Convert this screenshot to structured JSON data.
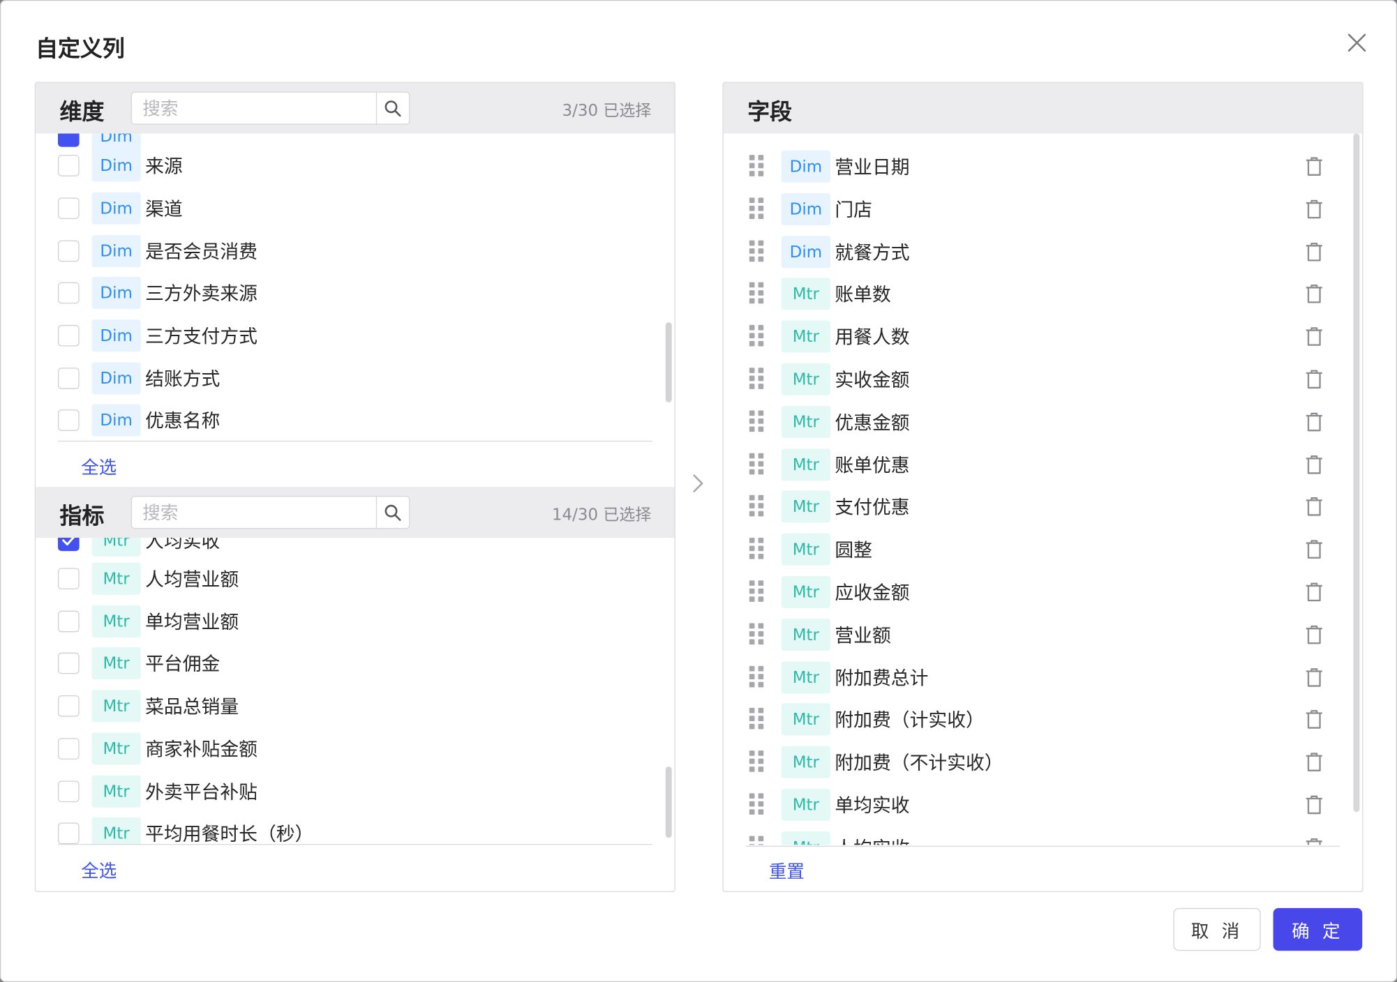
{
  "dialog": {
    "title": "自定义列",
    "cancel_label": "取 消",
    "ok_label": "确 定"
  },
  "dimensions": {
    "header": "维度",
    "search_placeholder": "搜索",
    "count": "3/30  已选择",
    "select_all": "全选",
    "items": [
      {
        "tag": "Dim",
        "label": "来源",
        "checked": false
      },
      {
        "tag": "Dim",
        "label": "渠道",
        "checked": false
      },
      {
        "tag": "Dim",
        "label": "是否会员消费",
        "checked": false
      },
      {
        "tag": "Dim",
        "label": "三方外卖来源",
        "checked": false
      },
      {
        "tag": "Dim",
        "label": "三方支付方式",
        "checked": false
      },
      {
        "tag": "Dim",
        "label": "结账方式",
        "checked": false
      },
      {
        "tag": "Dim",
        "label": "优惠名称",
        "checked": false
      }
    ]
  },
  "metrics": {
    "header": "指标",
    "search_placeholder": "搜索",
    "count": "14/30  已选择",
    "select_all": "全选",
    "items": [
      {
        "tag": "Mtr",
        "label": "人均实收",
        "checked": true
      },
      {
        "tag": "Mtr",
        "label": "人均营业额",
        "checked": false
      },
      {
        "tag": "Mtr",
        "label": "单均营业额",
        "checked": false
      },
      {
        "tag": "Mtr",
        "label": "平台佣金",
        "checked": false
      },
      {
        "tag": "Mtr",
        "label": "菜品总销量",
        "checked": false
      },
      {
        "tag": "Mtr",
        "label": "商家补贴金额",
        "checked": false
      },
      {
        "tag": "Mtr",
        "label": "外卖平台补贴",
        "checked": false
      },
      {
        "tag": "Mtr",
        "label": "平均用餐时长（秒）",
        "checked": false
      }
    ]
  },
  "fields": {
    "header": "字段",
    "reset_label": "重置",
    "items": [
      {
        "tag": "Dim",
        "label": "营业日期"
      },
      {
        "tag": "Dim",
        "label": "门店"
      },
      {
        "tag": "Dim",
        "label": "就餐方式"
      },
      {
        "tag": "Mtr",
        "label": "账单数"
      },
      {
        "tag": "Mtr",
        "label": "用餐人数"
      },
      {
        "tag": "Mtr",
        "label": "实收金额"
      },
      {
        "tag": "Mtr",
        "label": "优惠金额"
      },
      {
        "tag": "Mtr",
        "label": "账单优惠"
      },
      {
        "tag": "Mtr",
        "label": "支付优惠"
      },
      {
        "tag": "Mtr",
        "label": "圆整"
      },
      {
        "tag": "Mtr",
        "label": "应收金额"
      },
      {
        "tag": "Mtr",
        "label": "营业额"
      },
      {
        "tag": "Mtr",
        "label": "附加费总计"
      },
      {
        "tag": "Mtr",
        "label": "附加费（计实收）"
      },
      {
        "tag": "Mtr",
        "label": "附加费（不计实收）"
      },
      {
        "tag": "Mtr",
        "label": "单均实收"
      },
      {
        "tag": "Mtr",
        "label": "人均实收"
      }
    ]
  },
  "colors": {
    "accent": "#4747ea",
    "link": "#3f54ee",
    "dim_tag_bg": "#e7f3fe",
    "dim_tag_text": "#2f8ef2",
    "mtr_tag_bg": "#e4f8f5",
    "mtr_tag_text": "#2fb9a9",
    "header_bg": "#ececee"
  },
  "icons": {
    "close": "close-icon",
    "search": "search-icon",
    "drag": "drag-handle-icon",
    "delete": "trash-icon",
    "transfer": "chevron-right-icon"
  }
}
